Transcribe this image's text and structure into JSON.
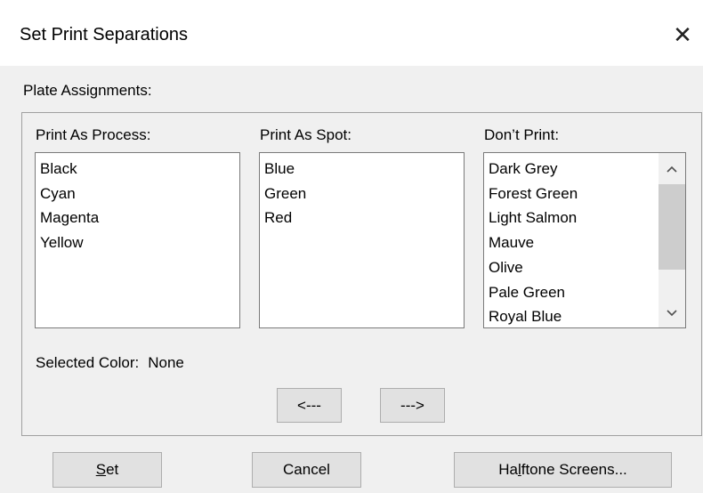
{
  "window": {
    "title": "Set Print Separations",
    "close_glyph": "✕"
  },
  "plate_assignments_label": "Plate Assignments:",
  "columns": {
    "process": {
      "label": "Print As Process:",
      "items": [
        "Black",
        "Cyan",
        "Magenta",
        "Yellow"
      ]
    },
    "spot": {
      "label": "Print As Spot:",
      "items": [
        "Blue",
        "Green",
        "Red"
      ]
    },
    "dont_print": {
      "label": "Don’t Print:",
      "items": [
        "Dark Grey",
        "Forest Green",
        "Light Salmon",
        "Mauve",
        "Olive",
        "Pale Green",
        "Royal Blue"
      ]
    }
  },
  "scrollbar": {
    "up_icon": "chevron-up-icon",
    "down_icon": "chevron-down-icon"
  },
  "selected_color": {
    "label": "Selected Color:",
    "value": "None"
  },
  "move_buttons": {
    "left_label": "<---",
    "right_label": "--->"
  },
  "buttons": {
    "set": {
      "accel": "S",
      "rest": "et"
    },
    "cancel": "Cancel",
    "halftone": {
      "pre": "Ha",
      "accel": "l",
      "post": "ftone Screens..."
    }
  }
}
